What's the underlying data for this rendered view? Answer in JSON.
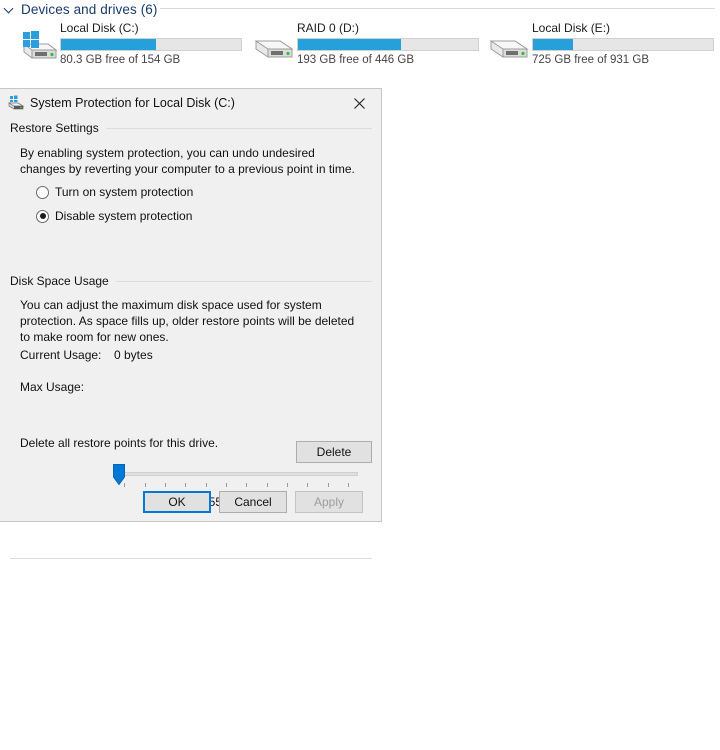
{
  "explorer": {
    "group_title": "Devices and drives (6)",
    "chevron_icon": "chevron-down-icon",
    "drives": [
      {
        "name": "Local Disk (C:)",
        "free_text": "80.3 GB free of 154 GB",
        "used_percent": 53,
        "icon": "hard-drive-windows-icon",
        "has_windows_badge": true
      },
      {
        "name": "RAID 0 (D:)",
        "free_text": "193 GB free of 446 GB",
        "used_percent": 57,
        "icon": "hard-drive-icon",
        "has_windows_badge": false
      },
      {
        "name": "Local Disk (E:)",
        "free_text": "725 GB free of 931 GB",
        "used_percent": 22,
        "icon": "hard-drive-icon",
        "has_windows_badge": false
      }
    ]
  },
  "dialog": {
    "title": "System Protection for Local Disk (C:)",
    "title_icon": "system-protection-drive-icon",
    "close_icon": "close-icon",
    "restore_settings": {
      "group_label": "Restore Settings",
      "description": "By enabling system protection, you can undo undesired changes by reverting your computer to a previous point in time.",
      "options": [
        {
          "label": "Turn on system protection",
          "checked": false
        },
        {
          "label": "Disable system protection",
          "checked": true
        }
      ]
    },
    "disk_space_usage": {
      "group_label": "Disk Space Usage",
      "description": "You can adjust the maximum disk space used for system protection. As space fills up, older restore points will be deleted to make room for new ones.",
      "current_usage_label": "Current Usage:",
      "current_usage_value": "0 bytes",
      "max_usage_label": "Max Usage:",
      "slider_value_text": "1% (1.55 GB)",
      "slider_percent": 1,
      "slider_tick_count": 12,
      "delete_description": "Delete all restore points for this drive.",
      "delete_button": "Delete"
    },
    "buttons": {
      "ok": "OK",
      "cancel": "Cancel",
      "apply": "Apply"
    }
  },
  "colors": {
    "accent_blue": "#26a0da",
    "focus_blue": "#0078d7",
    "header_blue": "#1a3a6b",
    "dialog_bg": "#f0f0f0"
  }
}
